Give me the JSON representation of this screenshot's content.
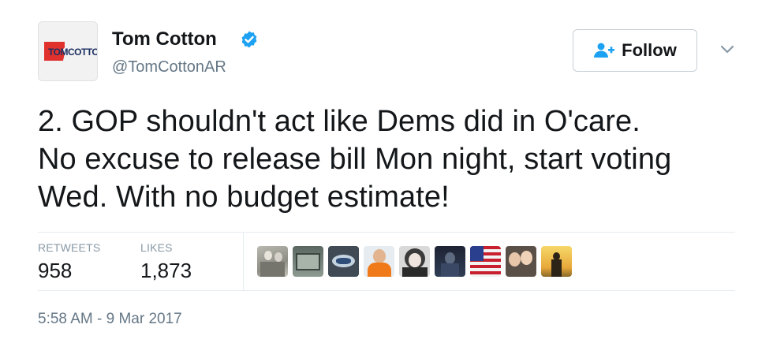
{
  "user": {
    "avatar_text": "TOMCOTTON",
    "name": "Tom Cotton",
    "handle": "@TomCottonAR",
    "verified_icon": "verified-badge-icon"
  },
  "actions": {
    "follow_label": "Follow",
    "follow_icon": "add-user-icon",
    "more_icon": "chevron-down-icon"
  },
  "tweet": {
    "lines": [
      "2. GOP shouldn't act like Dems did in O'care.",
      "No excuse to release bill Mon night, start voting",
      "Wed. With no budget estimate!"
    ]
  },
  "stats": {
    "retweets_label": "RETWEETS",
    "retweets_value": "958",
    "likes_label": "LIKES",
    "likes_value": "1,873"
  },
  "likers": [
    {
      "name": "liker-avatar-1"
    },
    {
      "name": "liker-avatar-2"
    },
    {
      "name": "liker-avatar-3"
    },
    {
      "name": "liker-avatar-4"
    },
    {
      "name": "liker-avatar-5"
    },
    {
      "name": "liker-avatar-6"
    },
    {
      "name": "liker-avatar-7"
    },
    {
      "name": "liker-avatar-8"
    },
    {
      "name": "liker-avatar-9"
    }
  ],
  "timestamp": "5:58 AM - 9 Mar 2017",
  "colors": {
    "accent": "#1da1f2",
    "text": "#14171a",
    "muted": "#657786",
    "label": "#8899a6",
    "border": "#e6ecf0"
  }
}
